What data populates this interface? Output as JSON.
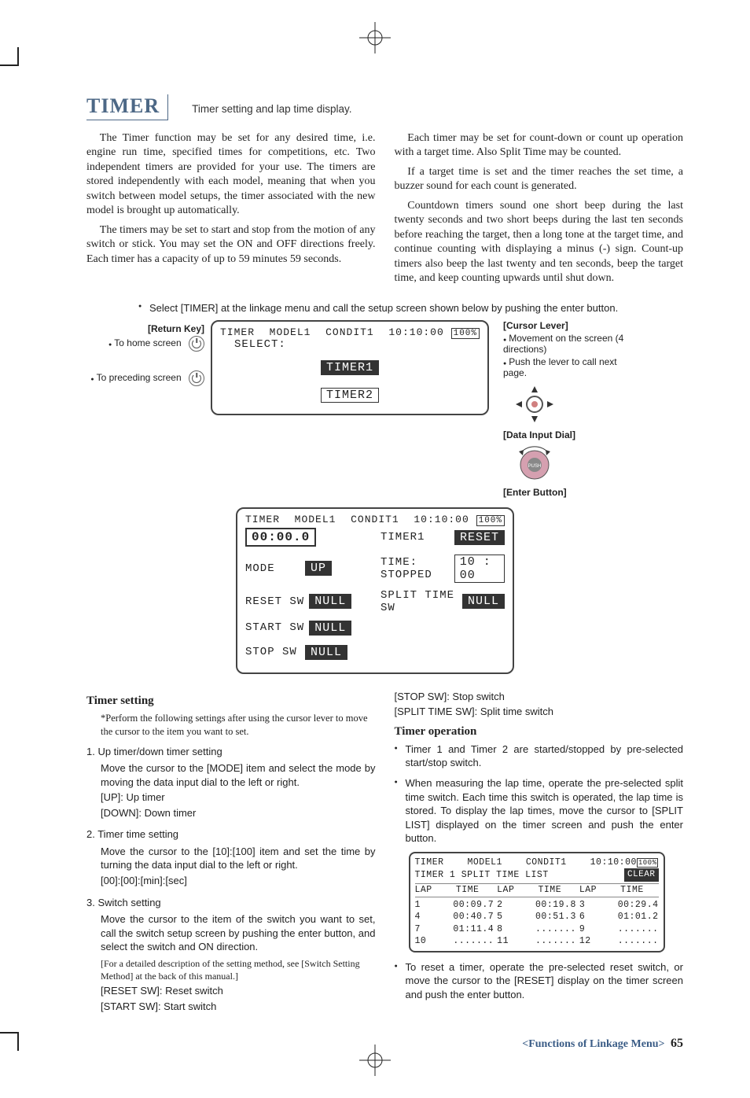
{
  "header": {
    "title": "TIMER",
    "subtitle": "Timer setting and lap time display."
  },
  "intro": {
    "left": [
      "The Timer function may be set for any desired time, i.e. engine run time, specified times for competitions, etc. Two independent timers are provided for your use. The timers are stored independently with each model, meaning that when you switch between model setups, the timer associated with the new model is brought up automatically.",
      "The timers may be set to start and stop from the motion of any switch or stick. You may set the ON and OFF directions freely. Each timer has a capacity of up to 59 minutes 59 seconds."
    ],
    "right": [
      "Each timer may be set for count-down or count up operation with a target time. Also Split Time may be counted.",
      "If a target time is set and the timer reaches the set time, a buzzer sound for each count is generated.",
      "Countdown timers sound one short beep during the last twenty seconds and two short beeps during the last ten seconds before reaching the target, then a long tone at the target time, and continue counting with displaying a minus (-) sign. Count-up timers also beep the last twenty and ten seconds, beep the target time, and keep counting upwards until shut down."
    ]
  },
  "lead_instruction": "Select [TIMER] at the linkage menu and call the setup screen shown below by pushing the enter button.",
  "keys": {
    "return_title": "[Return Key]",
    "return_home": "To home screen",
    "return_prev": "To preceding screen",
    "cursor_title": "[Cursor Lever]",
    "cursor_1": "Movement on the screen (4 directions)",
    "cursor_2": "Push the lever to call next page.",
    "dial_title": "[Data Input Dial]",
    "enter_title": "[Enter Button]",
    "push_label": "PUSH"
  },
  "lcd1": {
    "title": "TIMER",
    "model": "MODEL1",
    "cond": "CONDIT1",
    "clock": "10:10:00",
    "batt": "100%",
    "select": "SELECT:",
    "opt1": "TIMER1",
    "opt2": "TIMER2"
  },
  "lcd2": {
    "title": "TIMER",
    "model": "MODEL1",
    "cond": "CONDIT1",
    "clock": "10:10:00",
    "batt": "100%",
    "bigtime": "00:00.0",
    "name": "TIMER1",
    "reset": "RESET",
    "mode_l": "MODE",
    "mode_v": "UP",
    "time_l": "TIME: STOPPED",
    "time_v": "10 : 00",
    "resetsw_l": "RESET SW",
    "resetsw_v": "NULL",
    "splitsw_l": "SPLIT TIME SW",
    "splitsw_v": "NULL",
    "startsw_l": "START SW",
    "startsw_v": "NULL",
    "stopsw_l": "STOP SW",
    "stopsw_v": "NULL"
  },
  "setting": {
    "heading": "Timer setting",
    "note": "*Perform the following settings after using the cursor lever to move the cursor to the item you want to set.",
    "s1_t": "1. Up timer/down timer setting",
    "s1_b": "Move the cursor to the [MODE] item and select the mode by moving the data input dial to the left or right.",
    "s1_u": "[UP]: Up timer",
    "s1_d": "[DOWN]: Down timer",
    "s2_t": "2. Timer time setting",
    "s2_b": "Move the cursor to the [10]:[100] item and set the time by turning the data input dial to the left or right.",
    "s2_f": "[00]:[00]:[min]:[sec]",
    "s3_t": "3. Switch setting",
    "s3_b": "Move the cursor to the item of the switch you want to set, call the switch setup screen by pushing the enter button, and select the switch and ON direction.",
    "s3_n": "[For a detailed description of the setting method, see [Switch Setting Method] at the back of this manual.]",
    "s3_reset": "[RESET SW]: Reset switch",
    "s3_start": "[START SW]: Start switch",
    "s3_stop": "[STOP SW]: Stop switch",
    "s3_split": "[SPLIT TIME SW]: Split time switch"
  },
  "operation": {
    "heading": "Timer operation",
    "b1": "Timer 1 and Timer 2 are started/stopped by pre-selected start/stop switch.",
    "b2": "When measuring the lap time, operate the pre-selected split time switch. Each time this switch is operated, the lap time is stored. To display the lap times, move the cursor to [SPLIT LIST] displayed on the timer screen and push the enter button.",
    "b3": "To reset a timer, operate the pre-selected reset switch, or move the cursor to the [RESET] display on the timer screen and push the enter button."
  },
  "split_lcd": {
    "title": "TIMER",
    "model": "MODEL1",
    "cond": "CONDIT1",
    "clock": "10:10:00",
    "batt": "100%",
    "subtitle": "TIMER 1 SPLIT TIME LIST",
    "clear": "CLEAR",
    "th": [
      "LAP",
      "TIME",
      "LAP",
      "TIME",
      "LAP",
      "TIME"
    ],
    "rows": [
      [
        "1",
        "00:09.7",
        "2",
        "00:19.8",
        "3",
        "00:29.4"
      ],
      [
        "4",
        "00:40.7",
        "5",
        "00:51.3",
        "6",
        "01:01.2"
      ],
      [
        "7",
        "01:11.4",
        "8",
        ".......",
        "9",
        "......."
      ],
      [
        "10",
        ".......",
        "11",
        ".......",
        "12",
        "......."
      ]
    ]
  },
  "footer": {
    "text": "<Functions of Linkage Menu>",
    "page": "65"
  }
}
